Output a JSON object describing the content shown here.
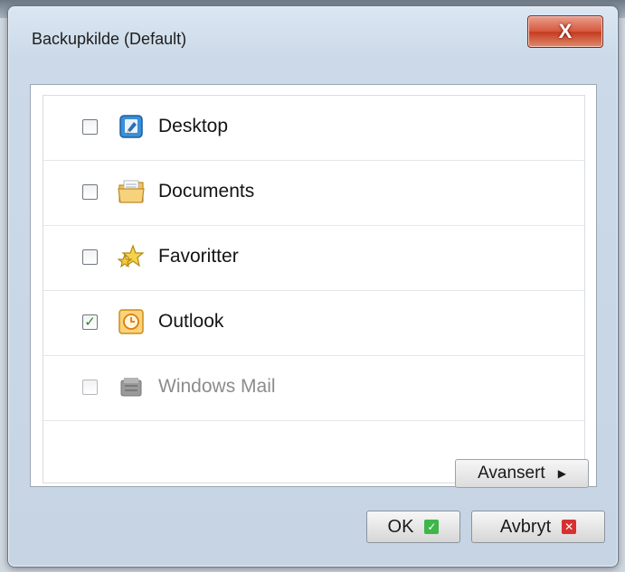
{
  "dialog": {
    "title": "Backupkilde (Default)",
    "close_symbol": "X"
  },
  "sources": [
    {
      "label": "Desktop",
      "checked": false,
      "enabled": true,
      "icon": "desktop-icon"
    },
    {
      "label": "Documents",
      "checked": false,
      "enabled": true,
      "icon": "documents-folder-icon"
    },
    {
      "label": "Favoritter",
      "checked": false,
      "enabled": true,
      "icon": "favorites-star-icon"
    },
    {
      "label": "Outlook",
      "checked": true,
      "enabled": true,
      "icon": "outlook-clock-icon"
    },
    {
      "label": "Windows Mail",
      "checked": false,
      "enabled": false,
      "icon": "windows-mail-icon"
    }
  ],
  "buttons": {
    "advanced": "Avansert",
    "ok": "OK",
    "cancel": "Avbryt"
  },
  "colors": {
    "ok_accent": "#3fb54a",
    "cancel_accent": "#d83030",
    "check_mark": "#2a8a2a"
  }
}
